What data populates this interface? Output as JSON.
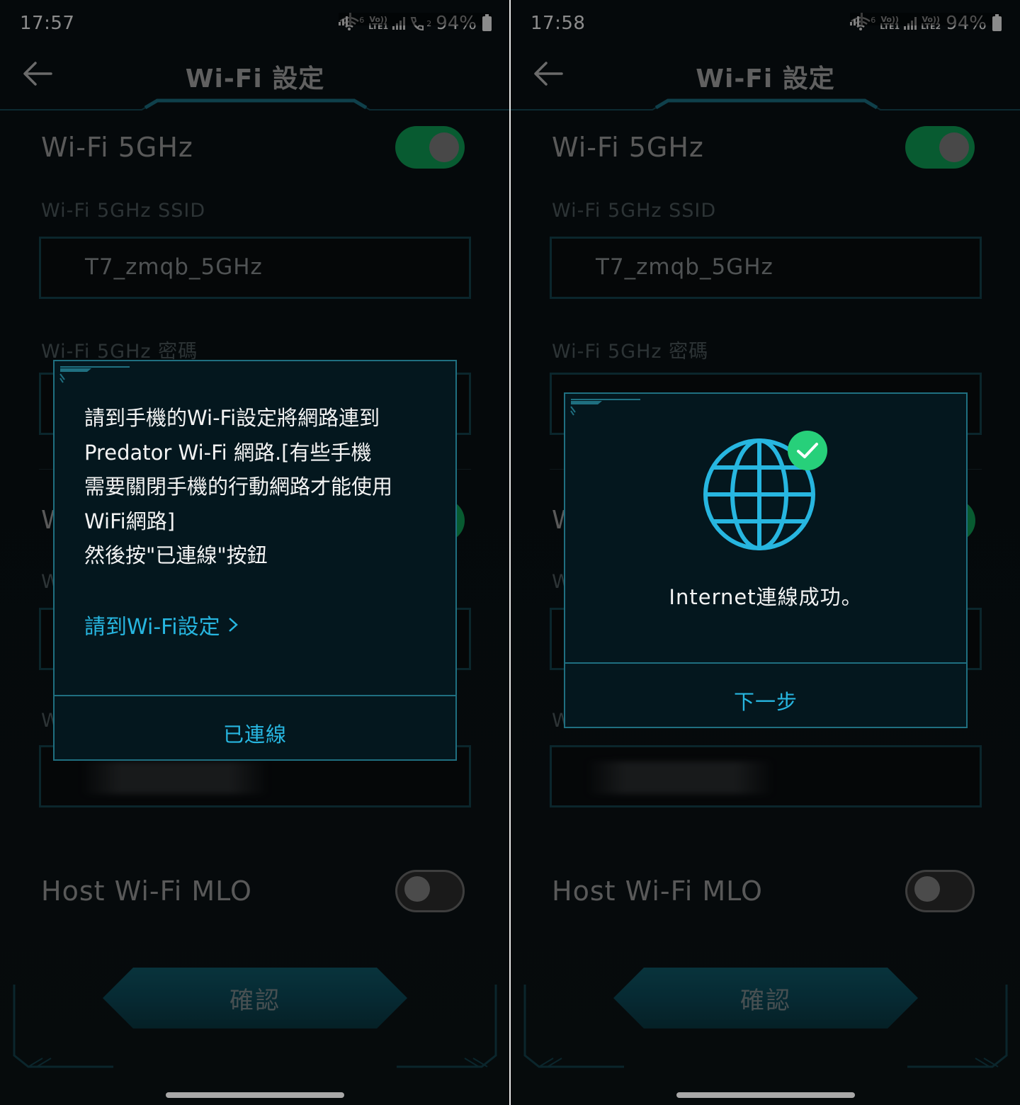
{
  "colors": {
    "accent": "#27b6e0",
    "toggle_on": "#0f9e55",
    "frame": "#1f6f80",
    "success": "#27d07a"
  },
  "icons": [
    "back-arrow-icon",
    "wifi-icon",
    "signal-icon",
    "volte-call-icon",
    "battery-icon",
    "chevron-right-icon",
    "globe-icon",
    "check-icon"
  ],
  "left": {
    "status": {
      "time": "17:57",
      "battery": "94%",
      "wifi_badge": "6",
      "sim1": "Vo)) LTE1",
      "sim2": "2"
    },
    "header": {
      "title": "Wi-Fi 設定"
    },
    "content": {
      "wifi5_label": "Wi-Fi 5GHz",
      "ssid_label": "Wi-Fi 5GHz SSID",
      "ssid_value": "T7_zmqb_5GHz",
      "password_label": "Wi-Fi 5GHz 密碼",
      "peek_letter": "W",
      "peek_letter2": "W",
      "peek_letter3": "W",
      "mlo_label": "Host Wi-Fi MLO",
      "confirm_label": "確認"
    },
    "dialog": {
      "message_lines": [
        "請到手機的Wi-Fi設定將網路連到",
        "Predator Wi-Fi 網路.[有些手機",
        "需要關閉手機的行動網路才能使用",
        "WiFi網路]",
        "然後按\"已連線\"按鈕"
      ],
      "link": "請到Wi-Fi設定",
      "action": "已連線"
    }
  },
  "right": {
    "status": {
      "time": "17:58",
      "battery": "94%",
      "wifi_badge": "6",
      "sim1": "Vo)) LTE1",
      "sim2": "Vo)) LTE2"
    },
    "header": {
      "title": "Wi-Fi 設定"
    },
    "content": {
      "wifi5_label": "Wi-Fi 5GHz",
      "ssid_label": "Wi-Fi 5GHz SSID",
      "ssid_value": "T7_zmqb_5GHz",
      "password_label": "Wi-Fi 5GHz 密碼",
      "peek_letter": "W",
      "peek_letter2": "W",
      "peek_letter3": "W",
      "mlo_label": "Host Wi-Fi MLO",
      "confirm_label": "確認"
    },
    "dialog": {
      "message": "Internet連線成功。",
      "action": "下一步"
    }
  }
}
